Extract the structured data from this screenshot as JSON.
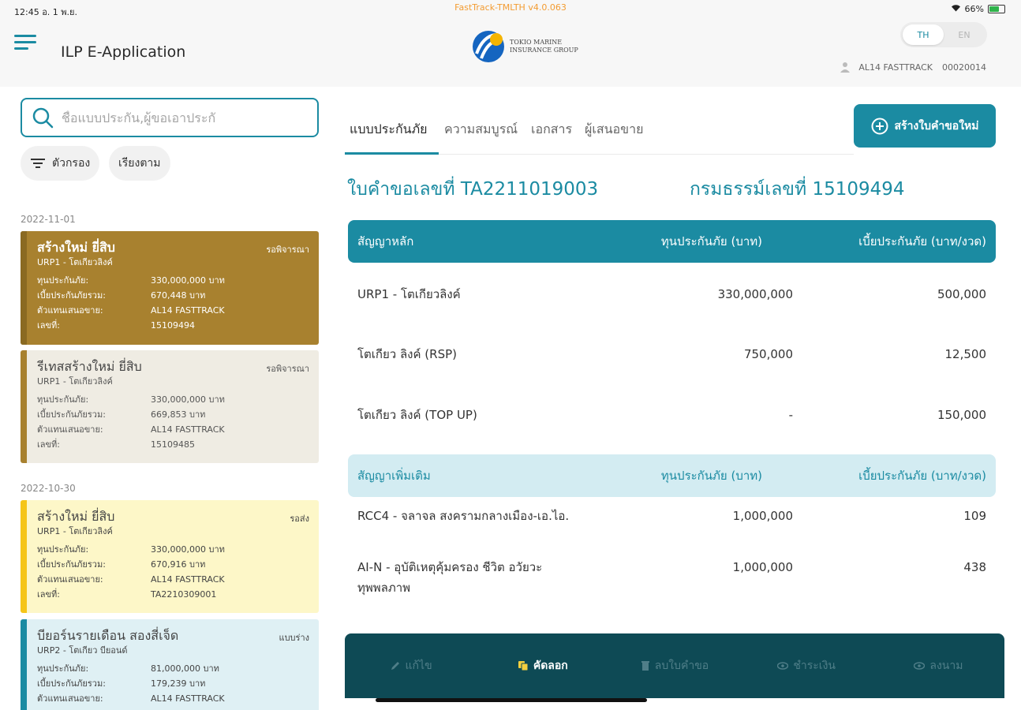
{
  "status_bar": {
    "time": "12:45 อ. 1 พ.ย.",
    "app_version": "FastTrack-TMLTH v4.0.063",
    "battery": "66%"
  },
  "header": {
    "title": "ILP E-Application",
    "logo_line1": "TOKIO MARINE",
    "logo_line2": "INSURANCE GROUP",
    "lang_th": "TH",
    "lang_en": "EN",
    "user_name": "AL14 FASTTRACK",
    "user_code": "00020014"
  },
  "search": {
    "placeholder": "ชื่อแบบประกัน,ผู้ขอเอาประกั"
  },
  "chips": {
    "filter": "ตัวกรอง",
    "sort": "เรียงตาม"
  },
  "groups": [
    {
      "date": "2022-11-01"
    },
    {
      "date": "2022-10-30"
    }
  ],
  "cards": [
    {
      "title": "สร้างใหม่ ยี่สิบ",
      "sub": "URP1 - โตเกียวลิงค์",
      "status": "รอพิจารณา",
      "rows": [
        [
          "ทุนประกันภัย:",
          "330,000,000 บาท"
        ],
        [
          "เบี้ยประกันภัยรวม:",
          "670,448 บาท"
        ],
        [
          "ตัวแทนเสนอขาย:",
          "AL14 FASTTRACK"
        ],
        [
          "เลขที่:",
          "15109494"
        ]
      ]
    },
    {
      "title": "รีเทสสร้างใหม่ ยี่สิบ",
      "sub": "URP1 - โตเกียวลิงค์",
      "status": "รอพิจารณา",
      "rows": [
        [
          "ทุนประกันภัย:",
          "330,000,000 บาท"
        ],
        [
          "เบี้ยประกันภัยรวม:",
          "669,853 บาท"
        ],
        [
          "ตัวแทนเสนอขาย:",
          "AL14 FASTTRACK"
        ],
        [
          "เลขที่:",
          "15109485"
        ]
      ]
    },
    {
      "title": "สร้างใหม่ ยี่สิบ",
      "sub": "URP1 - โตเกียวลิงค์",
      "status": "รอส่ง",
      "rows": [
        [
          "ทุนประกันภัย:",
          "330,000,000 บาท"
        ],
        [
          "เบี้ยประกันภัยรวม:",
          "670,916 บาท"
        ],
        [
          "ตัวแทนเสนอขาย:",
          "AL14 FASTTRACK"
        ],
        [
          "เลขที่:",
          "TA2210309001"
        ]
      ]
    },
    {
      "title": "บียอร์นรายเดือน สองสี่เจ็ด",
      "sub": "URP2 - โตเกียว บียอนด์",
      "status": "แบบร่าง",
      "rows": [
        [
          "ทุนประกันภัย:",
          "81,000,000 บาท"
        ],
        [
          "เบี้ยประกันภัยรวม:",
          "179,239 บาท"
        ],
        [
          "ตัวแทนเสนอขาย:",
          "AL14 FASTTRACK"
        ]
      ]
    }
  ],
  "tabs": [
    "แบบประกันภัย",
    "ความสมบูรณ์",
    "เอกสาร",
    "ผู้เสนอขาย"
  ],
  "new_button": "สร้างใบคำขอใหม่",
  "application_no": "ใบคำขอเลขที่ TA2211019003",
  "policy_no": "กรมธรรม์เลขที่ 15109494",
  "main_table": {
    "headers": [
      "สัญญาหลัก",
      "ทุนประกันภัย (บาท)",
      "เบี้ยประกันภัย (บาท/งวด)"
    ],
    "rows": [
      [
        "URP1 - โตเกียวลิงค์",
        "330,000,000",
        "500,000"
      ],
      [
        "โตเกียว ลิงค์ (RSP)",
        "750,000",
        "12,500"
      ],
      [
        "โตเกียว ลิงค์ (TOP UP)",
        "-",
        "150,000"
      ]
    ]
  },
  "rider_table": {
    "headers": [
      "สัญญาเพิ่มเติม",
      "ทุนประกันภัย (บาท)",
      "เบี้ยประกันภัย (บาท/งวด)"
    ],
    "rows": [
      [
        "RCC4 - จลาจล สงครามกลางเมือง-เอ.ไอ.",
        "1,000,000",
        "109"
      ],
      [
        "AI-N - อุบัติเหตุคุ้มครอง ชีวิต อวัยวะ ทุพพลภาพ",
        "1,000,000",
        "438"
      ]
    ]
  },
  "actions": [
    "แก้ไข",
    "คัดลอก",
    "ลบใบคำขอ",
    "ชำระเงิน",
    "ลงนาม"
  ],
  "colors": {
    "primary": "#1b8ba2",
    "dark": "#0e4a55",
    "gold": "#a8812f",
    "beige": "#efece3",
    "yellow": "#fdf7c8",
    "lightblue": "#dff0f4"
  }
}
